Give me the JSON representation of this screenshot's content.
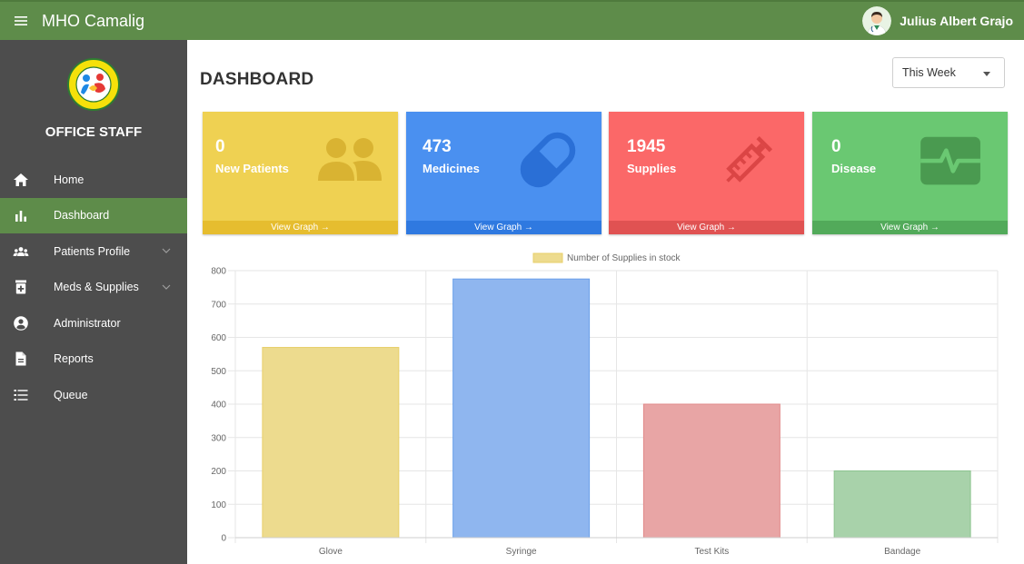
{
  "header": {
    "app_title": "MHO Camalig",
    "user_name": "Julius Albert Grajo"
  },
  "sidebar": {
    "role": "OFFICE STAFF",
    "items": [
      {
        "label": "Home",
        "icon": "home-icon",
        "active": false,
        "expandable": false
      },
      {
        "label": "Dashboard",
        "icon": "bar-chart-icon",
        "active": true,
        "expandable": false
      },
      {
        "label": "Patients Profile",
        "icon": "users-icon",
        "active": false,
        "expandable": true
      },
      {
        "label": "Meds & Supplies",
        "icon": "medicine-bottle-icon",
        "active": false,
        "expandable": true
      },
      {
        "label": "Administrator",
        "icon": "user-circle-icon",
        "active": false,
        "expandable": false
      },
      {
        "label": "Reports",
        "icon": "file-icon",
        "active": false,
        "expandable": false
      },
      {
        "label": "Queue",
        "icon": "list-icon",
        "active": false,
        "expandable": false
      }
    ]
  },
  "main": {
    "title": "DASHBOARD",
    "period_select": "This Week",
    "cards": [
      {
        "value": "0",
        "label": "New Patients",
        "footer": "View Graph →",
        "color": "#efd152",
        "footer_color": "#e6bd2f",
        "icon": "users-icon",
        "icon_color": "#d9b332"
      },
      {
        "value": "473",
        "label": "Medicines",
        "footer": "View Graph →",
        "color": "#4a90f0",
        "footer_color": "#2f79e0",
        "icon": "pill-icon",
        "icon_color": "#2a6fd6"
      },
      {
        "value": "1945",
        "label": "Supplies",
        "footer": "View Graph →",
        "color": "#fb6868",
        "footer_color": "#e05252",
        "icon": "syringe-icon",
        "icon_color": "#db4545"
      },
      {
        "value": "0",
        "label": "Disease",
        "footer": "View Graph →",
        "color": "#6ac872",
        "footer_color": "#52aa5a",
        "icon": "heart-monitor-icon",
        "icon_color": "#4a9a50"
      }
    ]
  },
  "chart_data": {
    "type": "bar",
    "categories": [
      "Glove",
      "Syringe",
      "Test Kits",
      "Bandage"
    ],
    "series": [
      {
        "name": "Number of Supplies in stock",
        "values": [
          570,
          775,
          400,
          200
        ]
      }
    ],
    "bar_colors": [
      "#eddb8e",
      "#8fb6ef",
      "#e8a5a5",
      "#a8d2aa"
    ],
    "bar_border_colors": [
      "#e8cf6a",
      "#6aa0ea",
      "#e18a8a",
      "#8cc48f"
    ],
    "ylim": [
      0,
      800
    ],
    "yticks": [
      0,
      100,
      200,
      300,
      400,
      500,
      600,
      700,
      800
    ],
    "grid": true,
    "legend": "top-center"
  }
}
